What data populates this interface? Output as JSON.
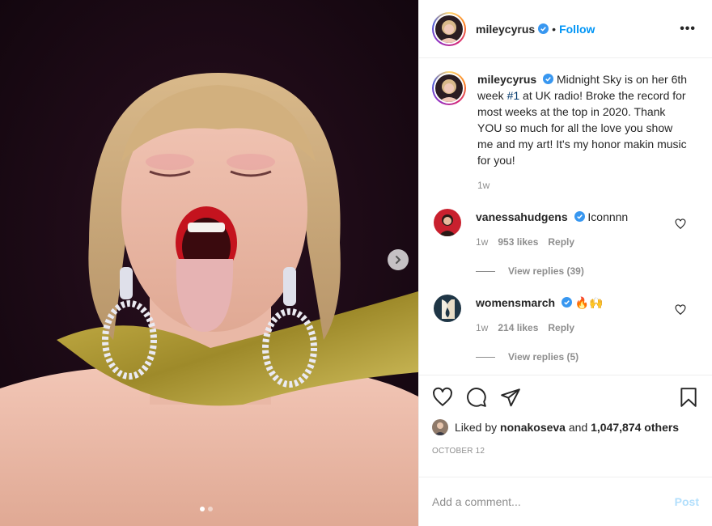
{
  "post": {
    "username": "mileycyrus",
    "follow_label": "Follow",
    "separator": "•",
    "more_label": "•••"
  },
  "caption": {
    "username": "mileycyrus",
    "text_before": "Midnight Sky is on her 6th week ",
    "hashtag": "#1",
    "text_after": " at UK radio! Broke the record for most weeks at the top in 2020. Thank YOU so much for all the love you show me and my art! It's my honor makin music for you!",
    "timestamp": "1w"
  },
  "comments": [
    {
      "username": "vanessahudgens",
      "text": "Iconnnn",
      "time": "1w",
      "likes": "953 likes",
      "reply_label": "Reply",
      "view_replies": "View replies (39)"
    },
    {
      "username": "womensmarch",
      "text": "🔥🙌",
      "time": "1w",
      "likes": "214 likes",
      "reply_label": "Reply",
      "view_replies": "View replies (5)"
    }
  ],
  "likes": {
    "prefix": "Liked by",
    "liker": "nonakoseva",
    "middle": "and",
    "count": "1,047,874 others"
  },
  "date": "OCTOBER 12",
  "add_comment": {
    "placeholder": "Add a comment...",
    "post_label": "Post"
  },
  "colors": {
    "accent": "#0095f6",
    "post_disabled": "#b2dffc",
    "verified": "#3897f0",
    "secondary_text": "#8e8e8e"
  },
  "carousel": {
    "current": 1,
    "total": 2
  }
}
